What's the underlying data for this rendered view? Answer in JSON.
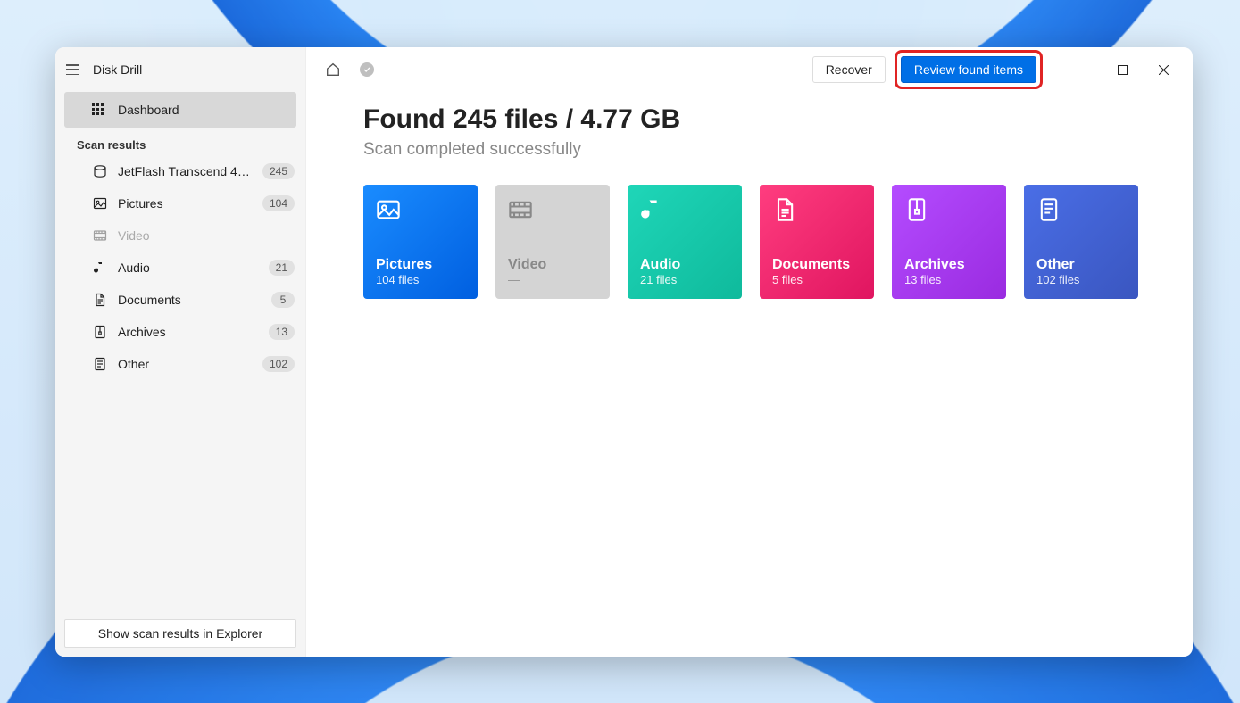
{
  "app": {
    "title": "Disk Drill"
  },
  "sidebar": {
    "dashboard": "Dashboard",
    "section": "Scan results",
    "items": [
      {
        "label": "JetFlash Transcend 4GB…",
        "count": "245",
        "icon": "drive"
      },
      {
        "label": "Pictures",
        "count": "104",
        "icon": "picture"
      },
      {
        "label": "Video",
        "count": "",
        "icon": "video",
        "disabled": true
      },
      {
        "label": "Audio",
        "count": "21",
        "icon": "audio"
      },
      {
        "label": "Documents",
        "count": "5",
        "icon": "document"
      },
      {
        "label": "Archives",
        "count": "13",
        "icon": "archive"
      },
      {
        "label": "Other",
        "count": "102",
        "icon": "other"
      }
    ],
    "footer_btn": "Show scan results in Explorer"
  },
  "topbar": {
    "recover": "Recover",
    "review": "Review found items"
  },
  "main": {
    "title": "Found 245 files / 4.77 GB",
    "subtitle": "Scan completed successfully"
  },
  "cards": [
    {
      "title": "Pictures",
      "sub": "104 files",
      "class": "pictures"
    },
    {
      "title": "Video",
      "sub": "—",
      "class": "video"
    },
    {
      "title": "Audio",
      "sub": "21 files",
      "class": "audio"
    },
    {
      "title": "Documents",
      "sub": "5 files",
      "class": "documents"
    },
    {
      "title": "Archives",
      "sub": "13 files",
      "class": "archives"
    },
    {
      "title": "Other",
      "sub": "102 files",
      "class": "other"
    }
  ]
}
